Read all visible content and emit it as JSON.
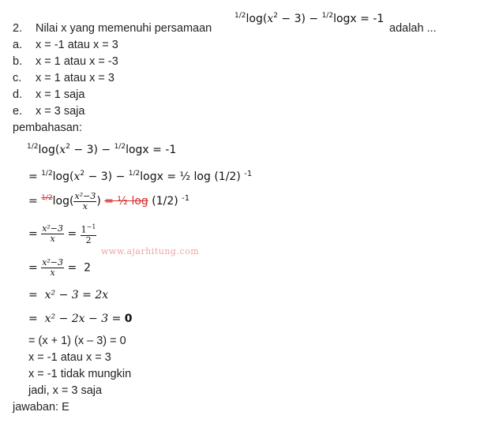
{
  "question": {
    "number": "2.",
    "text": "Nilai x yang memenuhi persamaan",
    "suffix": "adalah ...",
    "equation": {
      "base1": "1/2",
      "log_word": "log",
      "var": "x",
      "exp": "2",
      "minus3": " − 3)",
      "minus": " − ",
      "base2": "1/2",
      "logx": "logx = -1"
    }
  },
  "options": [
    {
      "label": "a.",
      "text": "x = -1 atau x = 3"
    },
    {
      "label": "b.",
      "text": "x = 1 atau x = -3"
    },
    {
      "label": "c.",
      "text": "x = 1 atau x = 3"
    },
    {
      "label": "d.",
      "text": "x = 1 saja"
    },
    {
      "label": "e.",
      "text": "x = 3 saja"
    }
  ],
  "solution_heading": "pembahasan:",
  "steps": {
    "s1_end": "logx = -1",
    "s2_prefix": "= ",
    "s2_end": "logx = ½ log (1/2)",
    "s2_exp": "-1",
    "s3_prefix": "= ",
    "s3_struck_base": "1/2",
    "s3_log": "log(",
    "s3_frac_num": "x²−3",
    "s3_frac_den": "x",
    "s3_close": ")",
    "s3_struck_rhs": "= ½ log",
    "s3_rest": " (1/2)",
    "s3_exp": "-1",
    "s4_rhs_num": "1",
    "s4_rhs_exp": "−1",
    "s4_rhs_den": "2",
    "s5_rhs": "2",
    "s6": "x² − 3 = 2x",
    "s7_lhs": "x² − 2x − 3 = ",
    "s7_zero": "0",
    "s8": "= (x + 1) (x – 3) = 0",
    "s9": "x = -1 atau x = 3",
    "s10": "x = -1 tidak mungkin",
    "s11": "jadi, x = 3 saja"
  },
  "answer": "jawaban: E",
  "watermark": "www.ajarhitung.com"
}
